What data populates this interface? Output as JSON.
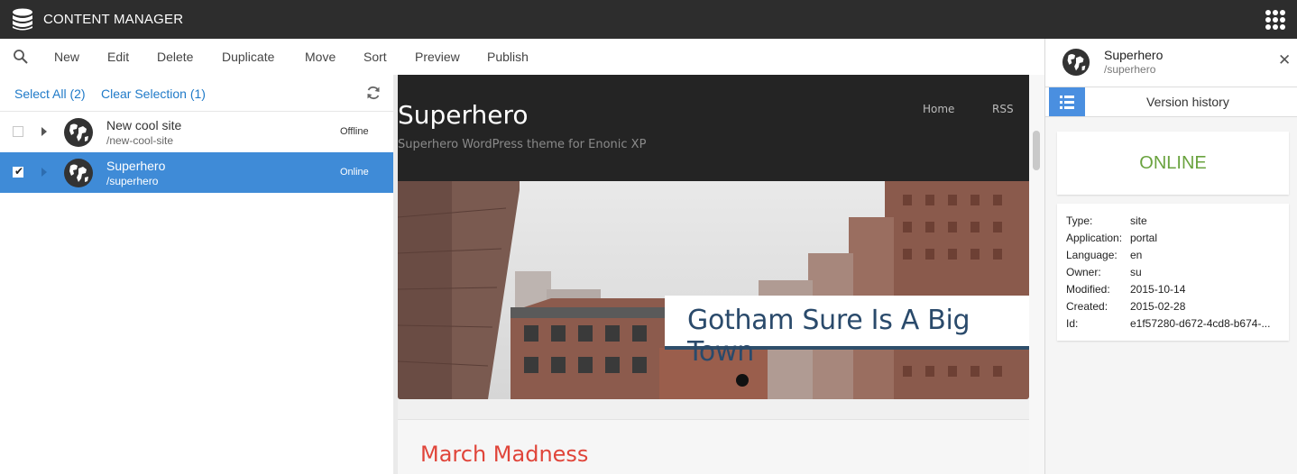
{
  "app": {
    "title": "CONTENT MANAGER",
    "icon": "database-icon",
    "apps_icon": "apps-grid-icon"
  },
  "toolbar": {
    "search_icon": "search-icon",
    "buttons": [
      "New",
      "Edit",
      "Delete",
      "Duplicate",
      "Move",
      "Sort",
      "Preview",
      "Publish"
    ]
  },
  "selection": {
    "select_all": "Select All (2)",
    "clear_selection": "Clear Selection (1)",
    "refresh_icon": "refresh-icon"
  },
  "content_list": [
    {
      "name": "New cool site",
      "path": "/new-cool-site",
      "status": "Offline",
      "checked": false
    },
    {
      "name": "Superhero",
      "path": "/superhero",
      "status": "Online",
      "checked": true
    }
  ],
  "preview": {
    "site_title": "Superhero",
    "site_subtitle": "Superhero WordPress theme for Enonic XP",
    "nav": [
      "Home",
      "RSS"
    ],
    "hero_caption": "Gotham Sure Is A Big Town",
    "post_title": "March Madness"
  },
  "details": {
    "name": "Superhero",
    "path": "/superhero",
    "tab_label": "Version history",
    "status": "ONLINE",
    "properties": [
      {
        "key": "Type:",
        "value": "site"
      },
      {
        "key": "Application:",
        "value": "portal"
      },
      {
        "key": "Language:",
        "value": "en"
      },
      {
        "key": "Owner:",
        "value": "su"
      },
      {
        "key": "Modified:",
        "value": "2015-10-14"
      },
      {
        "key": "Created:",
        "value": "2015-02-28"
      },
      {
        "key": "Id:",
        "value": "e1f57280-d672-4cd8-b674-..."
      }
    ]
  },
  "colors": {
    "topbar": "#2d2d2d",
    "selected_row": "#3f8bd7",
    "link": "#1f7ac8",
    "online": "#6aa33f",
    "post_title": "#e0453a"
  }
}
